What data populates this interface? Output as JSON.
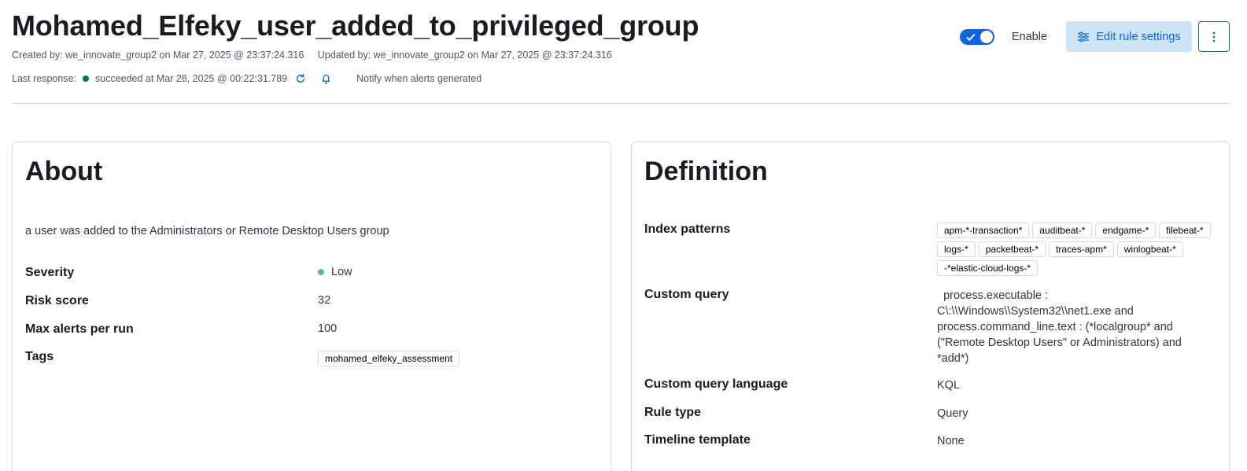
{
  "rule": {
    "title": "Mohamed_Elfeky_user_added_to_privileged_group",
    "created": "Created by: we_innovate_group2 on Mar 27, 2025 @ 23:37:24.316",
    "updated": "Updated by: we_innovate_group2 on Mar 27, 2025 @ 23:37:24.316",
    "last_response_label": "Last response:",
    "last_response_status": "succeeded at Mar 28, 2025 @ 00:22:31.789",
    "notify_text": "Notify when alerts generated"
  },
  "actions": {
    "enable_label": "Enable",
    "enabled": true,
    "edit_label": "Edit rule settings"
  },
  "about": {
    "title": "About",
    "description": "a user was added to the Administrators or Remote Desktop Users group",
    "severity_label": "Severity",
    "severity_value": "Low",
    "risk_label": "Risk score",
    "risk_value": "32",
    "max_alerts_label": "Max alerts per run",
    "max_alerts_value": "100",
    "tags_label": "Tags",
    "tags": [
      "mohamed_elfeky_assessment"
    ]
  },
  "definition": {
    "title": "Definition",
    "index_label": "Index patterns",
    "index_patterns": [
      "apm-*-transaction*",
      "auditbeat-*",
      "endgame-*",
      "filebeat-*",
      "logs-*",
      "packetbeat-*",
      "traces-apm*",
      "winlogbeat-*",
      "-*elastic-cloud-logs-*"
    ],
    "query_label": "Custom query",
    "query_value": "  process.executable : C\\:\\\\Windows\\\\System32\\\\net1.exe and process.command_line.text : (*localgroup* and (\"Remote Desktop Users\" or Administrators) and *add*)",
    "query_lang_label": "Custom query language",
    "query_lang_value": "KQL",
    "rule_type_label": "Rule type",
    "rule_type_value": "Query",
    "timeline_label": "Timeline template",
    "timeline_value": "None"
  },
  "colors": {
    "primary": "#0b64dd",
    "success": "#00785a",
    "severity_low": "#54b399"
  }
}
